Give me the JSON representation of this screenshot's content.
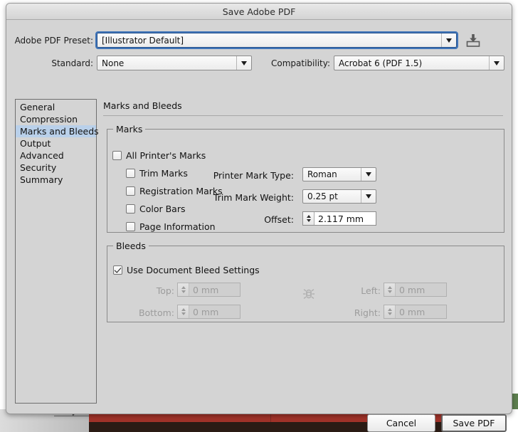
{
  "dialog": {
    "title": "Save Adobe PDF"
  },
  "preset": {
    "label": "Adobe PDF Preset:",
    "value": "[Illustrator Default]",
    "save_icon": "save-preset-icon"
  },
  "standard": {
    "label": "Standard:",
    "value": "None"
  },
  "compatibility": {
    "label": "Compatibility:",
    "value": "Acrobat 6 (PDF 1.5)"
  },
  "sidebar": {
    "items": [
      {
        "label": "General",
        "selected": false
      },
      {
        "label": "Compression",
        "selected": false
      },
      {
        "label": "Marks and Bleeds",
        "selected": true
      },
      {
        "label": "Output",
        "selected": false
      },
      {
        "label": "Advanced",
        "selected": false
      },
      {
        "label": "Security",
        "selected": false
      },
      {
        "label": "Summary",
        "selected": false
      }
    ]
  },
  "panel": {
    "title": "Marks and Bleeds",
    "marks": {
      "legend": "Marks",
      "all_printers_marks": {
        "label": "All Printer's Marks",
        "checked": false
      },
      "trim_marks": {
        "label": "Trim Marks",
        "checked": false
      },
      "registration_marks": {
        "label": "Registration Marks",
        "checked": false
      },
      "color_bars": {
        "label": "Color Bars",
        "checked": false
      },
      "page_information": {
        "label": "Page Information",
        "checked": false
      },
      "printer_mark_type": {
        "label": "Printer Mark Type:",
        "value": "Roman"
      },
      "trim_mark_weight": {
        "label": "Trim Mark Weight:",
        "value": "0.25 pt"
      },
      "offset": {
        "label": "Offset:",
        "value": "2.117 mm"
      }
    },
    "bleeds": {
      "legend": "Bleeds",
      "use_document_bleed": {
        "label": "Use Document Bleed Settings",
        "checked": true
      },
      "top": {
        "label": "Top:",
        "value": "0 mm"
      },
      "bottom": {
        "label": "Bottom:",
        "value": "0 mm"
      },
      "left": {
        "label": "Left:",
        "value": "0 mm"
      },
      "right": {
        "label": "Right:",
        "value": "0 mm"
      },
      "link_icon": "link-chain-icon"
    }
  },
  "footer": {
    "cancel": "Cancel",
    "save": "Save PDF"
  },
  "colors": {
    "dialog_bg": "#d4d4d4",
    "selection": "#b9d0ea",
    "focus_ring": "#3f74b8",
    "text": "#111111",
    "disabled_text": "#9c9c9c"
  }
}
